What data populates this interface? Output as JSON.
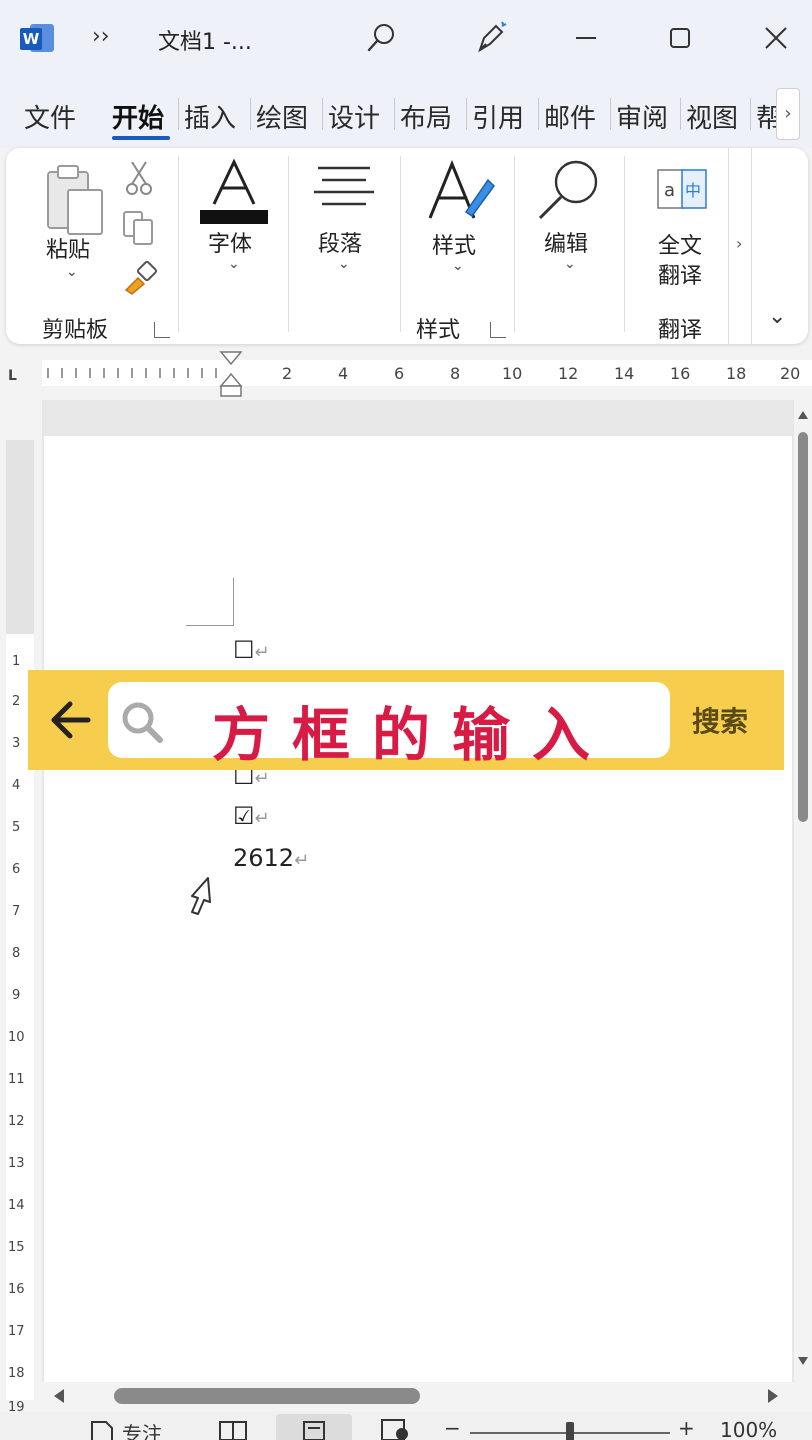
{
  "app": {
    "title": "文档1  -...",
    "more_glyph": "››",
    "logo_letter": "W"
  },
  "tabs": [
    {
      "label": "文件"
    },
    {
      "label": "开始"
    },
    {
      "label": "插入"
    },
    {
      "label": "绘图"
    },
    {
      "label": "设计"
    },
    {
      "label": "布局"
    },
    {
      "label": "引用"
    },
    {
      "label": "邮件"
    },
    {
      "label": "审阅"
    },
    {
      "label": "视图"
    },
    {
      "label": "帮"
    }
  ],
  "tab_scroll": "›",
  "ribbon": {
    "paste_label": "粘贴",
    "font_label": "字体",
    "paragraph_label": "段落",
    "styles_label": "样式",
    "edit_label": "编辑",
    "translate_line1": "全文",
    "translate_line2": "翻译",
    "group_clipboard": "剪贴板",
    "group_styles": "样式",
    "group_translate": "翻译",
    "caret": "⌄",
    "more": "›",
    "collapse": "⌄"
  },
  "ruler": {
    "corner": "L",
    "numbers": [
      "2",
      "4",
      "6",
      "8",
      "10",
      "12",
      "14",
      "16",
      "18",
      "20"
    ],
    "vnumbers": [
      "1",
      "2",
      "3",
      "4",
      "5",
      "6",
      "7",
      "8",
      "9",
      "10",
      "11",
      "12",
      "13",
      "14",
      "15",
      "16",
      "17",
      "18",
      "19"
    ]
  },
  "document": {
    "lines": [
      {
        "text": "☐"
      },
      {
        "text": "☐"
      },
      {
        "text": "☑"
      },
      {
        "text": "2612"
      }
    ],
    "return_mark": "↵"
  },
  "search_overlay": {
    "query": "方框的输入",
    "button": "搜索"
  },
  "statusbar": {
    "focus_label": "专注",
    "zoom_minus": "−",
    "zoom_plus": "+",
    "zoom": "100%",
    "zoom_level": 0.5
  },
  "colors": {
    "word_blue": "#185abd",
    "overlay_yellow": "#f6cd4c",
    "query_red": "#d81b44"
  }
}
